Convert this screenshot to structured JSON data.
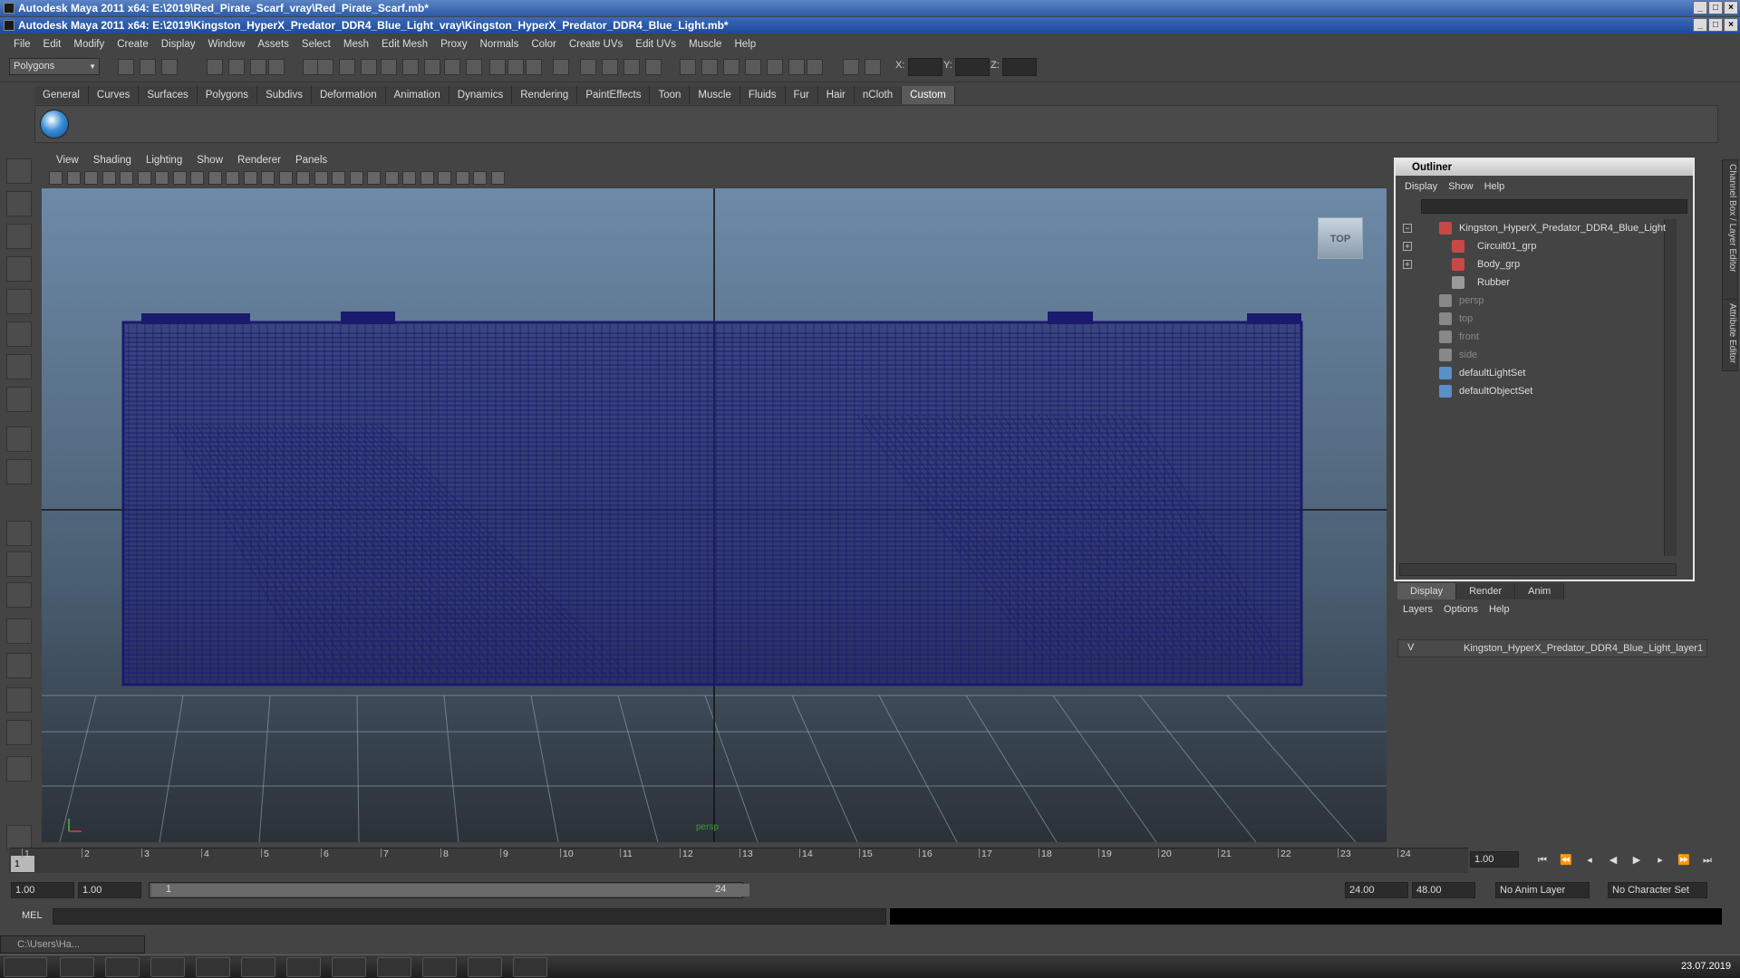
{
  "window1_title": "Autodesk Maya 2011 x64: E:\\2019\\Red_Pirate_Scarf_vray\\Red_Pirate_Scarf.mb*",
  "window2_title": "Autodesk Maya 2011 x64: E:\\2019\\Kingston_HyperX_Predator_DDR4_Blue_Light_vray\\Kingston_HyperX_Predator_DDR4_Blue_Light.mb*",
  "menu": [
    "File",
    "Edit",
    "Modify",
    "Create",
    "Display",
    "Window",
    "Assets",
    "Select",
    "Mesh",
    "Edit Mesh",
    "Proxy",
    "Normals",
    "Color",
    "Create UVs",
    "Edit UVs",
    "Muscle",
    "Help"
  ],
  "mode_selector": "Polygons",
  "coords": {
    "x": "X:",
    "y": "Y:",
    "z": "Z:"
  },
  "shelf_tabs": [
    "General",
    "Curves",
    "Surfaces",
    "Polygons",
    "Subdivs",
    "Deformation",
    "Animation",
    "Dynamics",
    "Rendering",
    "PaintEffects",
    "Toon",
    "Muscle",
    "Fluids",
    "Fur",
    "Hair",
    "nCloth",
    "Custom"
  ],
  "active_shelf_tab": "Custom",
  "viewport_menu": [
    "View",
    "Shading",
    "Lighting",
    "Show",
    "Renderer",
    "Panels"
  ],
  "viewport": {
    "cube_label": "TOP",
    "camera_label": "persp",
    "axis_y": "y",
    "axis_x": "x"
  },
  "outliner": {
    "title": "Outliner",
    "menu": [
      "Display",
      "Show",
      "Help"
    ],
    "items": [
      {
        "label": "Kingston_HyperX_Predator_DDR4_Blue_Light",
        "indent": 0,
        "expand": "−",
        "dim": false,
        "icon": "group-icon"
      },
      {
        "label": "Circuit01_grp",
        "indent": 1,
        "expand": "+",
        "dim": false,
        "icon": "group-icon"
      },
      {
        "label": "Body_grp",
        "indent": 1,
        "expand": "+",
        "dim": false,
        "icon": "group-icon"
      },
      {
        "label": "Rubber",
        "indent": 1,
        "expand": "",
        "dim": false,
        "icon": "mesh-icon"
      },
      {
        "label": "persp",
        "indent": 0,
        "expand": "",
        "dim": true,
        "icon": "camera-icon"
      },
      {
        "label": "top",
        "indent": 0,
        "expand": "",
        "dim": true,
        "icon": "camera-icon"
      },
      {
        "label": "front",
        "indent": 0,
        "expand": "",
        "dim": true,
        "icon": "camera-icon"
      },
      {
        "label": "side",
        "indent": 0,
        "expand": "",
        "dim": true,
        "icon": "camera-icon"
      },
      {
        "label": "defaultLightSet",
        "indent": 0,
        "expand": "",
        "dim": false,
        "icon": "set-icon"
      },
      {
        "label": "defaultObjectSet",
        "indent": 0,
        "expand": "",
        "dim": false,
        "icon": "set-icon"
      }
    ]
  },
  "layer_editor": {
    "tabs": [
      "Display",
      "Render",
      "Anim"
    ],
    "active_tab": "Display",
    "menu": [
      "Layers",
      "Options",
      "Help"
    ],
    "layer": {
      "visible": "V",
      "name": "Kingston_HyperX_Predator_DDR4_Blue_Light_layer1"
    }
  },
  "side_tabs": [
    "Channel Box / Layer Editor",
    "Attribute Editor"
  ],
  "timeline": {
    "ticks": [
      "1",
      "2",
      "3",
      "4",
      "5",
      "6",
      "7",
      "8",
      "9",
      "10",
      "11",
      "12",
      "13",
      "14",
      "15",
      "16",
      "17",
      "18",
      "19",
      "20",
      "21",
      "22",
      "23",
      "24"
    ],
    "current": "1",
    "current_time_field": "1.00"
  },
  "range": {
    "start": "1.00",
    "current_start": "1.00",
    "slider_start": "1",
    "slider_end": "24",
    "end": "24.00",
    "max_end": "48.00",
    "anim_layer": "No Anim Layer",
    "char_set": "No Character Set"
  },
  "mel_label": "MEL",
  "minimized_window": "C:\\Users\\Ha...",
  "taskbar_date": "23.07.2019",
  "colors": {
    "wire": "#1a1a6e",
    "accent": "#2d5aa8"
  }
}
